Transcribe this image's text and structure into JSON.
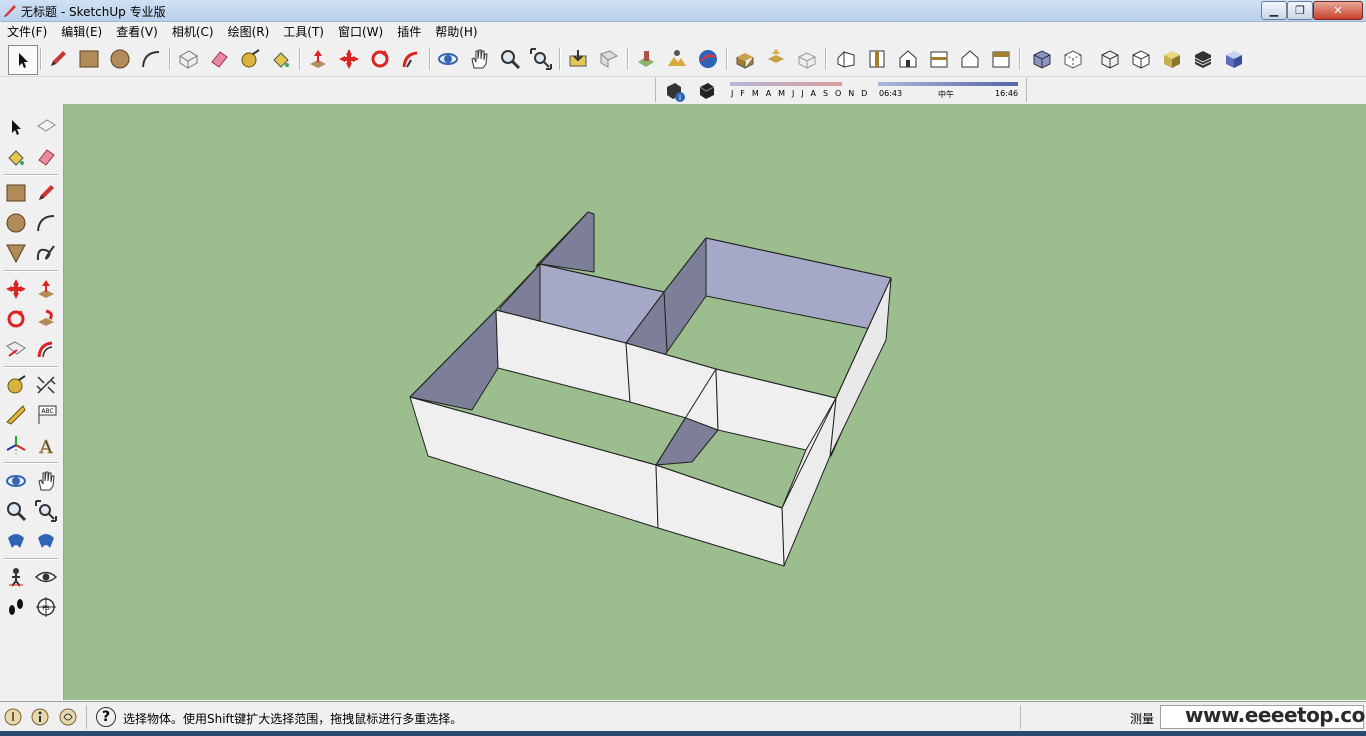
{
  "window": {
    "title": "无标题 - SketchUp 专业版",
    "controls": {
      "minimize": "▁",
      "maximize": "❐",
      "close": "✕"
    }
  },
  "menu": [
    "文件(F)",
    "编辑(E)",
    "查看(V)",
    "相机(C)",
    "绘图(R)",
    "工具(T)",
    "窗口(W)",
    "插件",
    "帮助(H)"
  ],
  "shadow_settings": {
    "months": "J F M A M J J A S O N D",
    "time_start": "06:43",
    "time_noon": "中午",
    "time_end": "16:46"
  },
  "status": {
    "help_icon": "?",
    "message": "选择物体。使用Shift键扩大选择范围，拖拽鼠标进行多重选择。",
    "measure_label": "测量",
    "measure_value": ""
  },
  "watermark": "www.eeeetop.com",
  "colors": {
    "viewport_bg": "#9cbd8e",
    "wall_front": "#efefef",
    "wall_back": "#a5a9c7",
    "wall_side": "#7d7f98",
    "wall_top": "#ffffff",
    "edge": "#222222"
  }
}
